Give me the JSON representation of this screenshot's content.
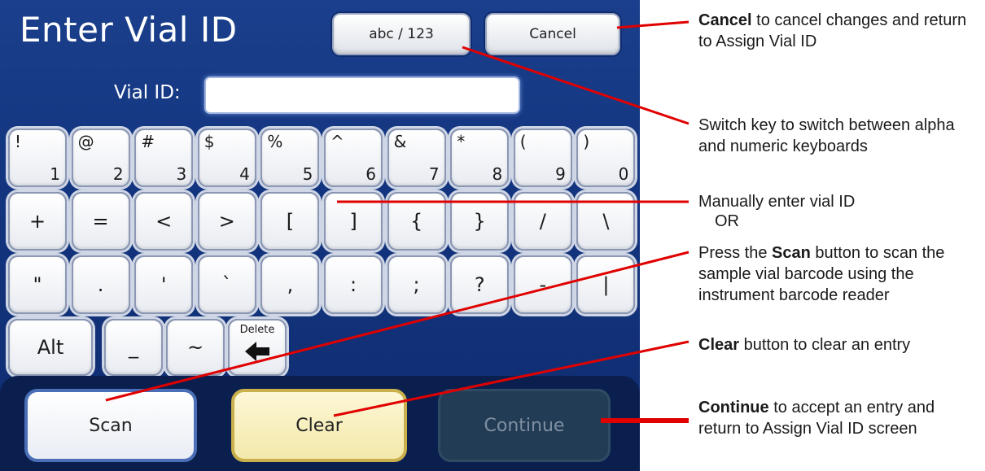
{
  "screen": {
    "title": "Enter Vial ID",
    "toggle_label": "abc / 123",
    "cancel_label": "Cancel",
    "vial_id_label": "Vial ID:",
    "vial_id_value": "",
    "keys_row1": [
      {
        "top": "!",
        "bottom": "1"
      },
      {
        "top": "@",
        "bottom": "2"
      },
      {
        "top": "#",
        "bottom": "3"
      },
      {
        "top": "$",
        "bottom": "4"
      },
      {
        "top": "%",
        "bottom": "5"
      },
      {
        "top": "^",
        "bottom": "6"
      },
      {
        "top": "&",
        "bottom": "7"
      },
      {
        "top": "*",
        "bottom": "8"
      },
      {
        "top": "(",
        "bottom": "9"
      },
      {
        "top": ")",
        "bottom": "0"
      }
    ],
    "keys_row2": [
      "+",
      "=",
      "<",
      ">",
      "[",
      "]",
      "{",
      "}",
      "/",
      "\\"
    ],
    "keys_row3": [
      "\"",
      ".",
      "'",
      "`",
      ",",
      ":",
      ";",
      "?",
      "-",
      "|"
    ],
    "keys_row4": {
      "alt": "Alt",
      "underscore": "_",
      "tilde": "~",
      "delete": "Delete"
    },
    "scan_label": "Scan",
    "clear_label": "Clear",
    "continue_label": "Continue"
  },
  "annotations": {
    "cancel": {
      "bold": "Cancel",
      "rest": " to cancel changes and return to Assign Vial ID"
    },
    "switch": "Switch key to switch between alpha and numeric keyboards",
    "manual": "Manually enter vial ID",
    "or": "OR",
    "scan": {
      "pre": "Press the ",
      "bold": "Scan",
      "rest": " button to scan the sample vial barcode using the instrument barcode reader"
    },
    "clear": {
      "bold": "Clear",
      "rest": " button to clear an entry"
    },
    "continue": {
      "bold": "Continue",
      "rest": " to accept an entry and return to Assign Vial ID screen"
    }
  },
  "colors": {
    "screen_bg": "#13357f",
    "callout_line": "#e00000"
  }
}
